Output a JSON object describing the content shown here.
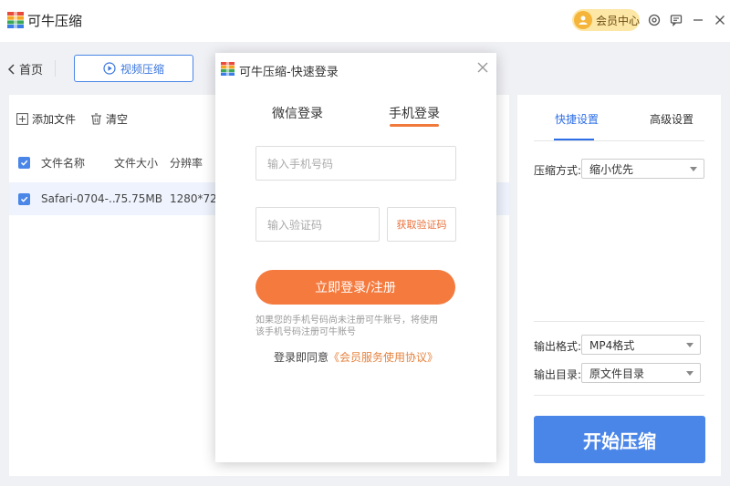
{
  "app": {
    "title": "可牛压缩"
  },
  "titlebar": {
    "vip_label": "会员中心"
  },
  "toolbar": {
    "back_label": "首页",
    "video_label": "视频压缩"
  },
  "file_panel": {
    "add_label": "添加文件",
    "clear_label": "清空",
    "columns": [
      "文件名称",
      "文件大小",
      "分辨率"
    ],
    "rows": [
      {
        "name": "Safari-0704-...",
        "size": "75.75MB",
        "resolution": "1280*720"
      }
    ]
  },
  "settings": {
    "tabs": [
      "快捷设置",
      "高级设置"
    ],
    "compress_label": "压缩方式:",
    "compress_value": "缩小优先",
    "format_label": "输出格式:",
    "format_value": "MP4格式",
    "dir_label": "输出目录:",
    "dir_value": "原文件目录",
    "start_label": "开始压缩"
  },
  "dialog": {
    "title": "可牛压缩-快速登录",
    "tabs": [
      "微信登录",
      "手机登录"
    ],
    "phone_placeholder": "输入手机号码",
    "code_placeholder": "输入验证码",
    "get_code_label": "获取验证码",
    "login_label": "立即登录/注册",
    "note_line1": "如果您的手机号码尚未注册可牛账号，将使用",
    "note_line2": "该手机号码注册可牛账号",
    "agree_prefix": "登录即同意",
    "agree_link": "《会员服务使用协议》"
  },
  "colors": {
    "accent_blue": "#4a86e8",
    "accent_orange": "#f47a3e"
  }
}
